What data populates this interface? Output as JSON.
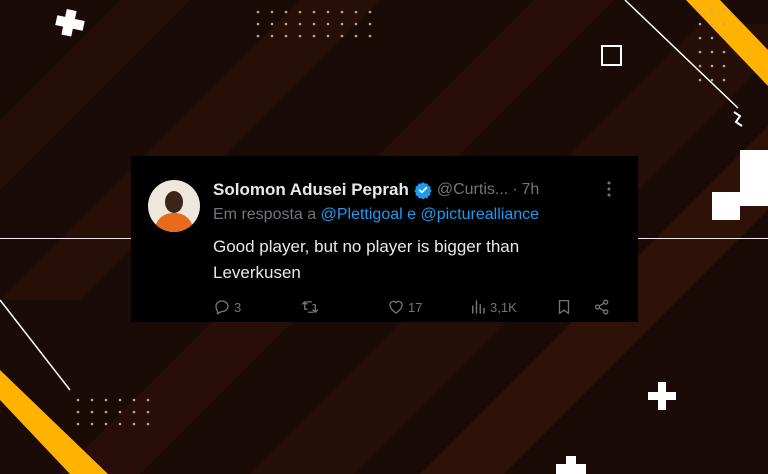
{
  "tweet": {
    "name": "Solomon Adusei Peprah",
    "handle": "@Curtis...",
    "separator": "·",
    "time": "7h",
    "reply_prefix": "Em resposta a",
    "reply_mention_1": "@Plettigoal",
    "reply_joiner": "e",
    "reply_mention_2": "@picturealliance",
    "text_line_1": "Good player, but no player is bigger than",
    "text_line_2": "Leverkusen",
    "replies": "3",
    "likes": "17",
    "views": "3,1K"
  },
  "colors": {
    "background": "#1a0b07",
    "card": "#000000",
    "accent": "#1d9bf0",
    "muted": "#71767b",
    "yellow": "#ffb300"
  },
  "icons": [
    "verified-badge-icon",
    "more-icon",
    "reply-icon",
    "retweet-icon",
    "like-icon",
    "views-icon",
    "bookmark-icon",
    "share-icon"
  ]
}
